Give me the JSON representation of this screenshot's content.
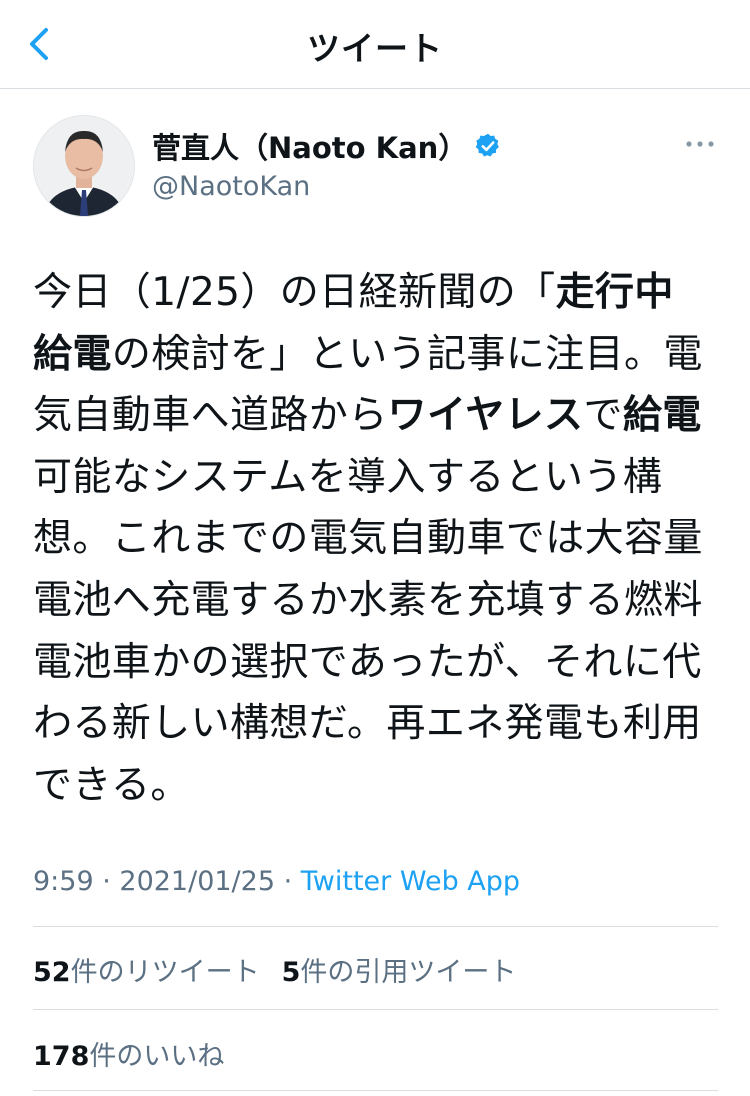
{
  "nav": {
    "title": "ツイート",
    "back_icon": "chevron-left-icon"
  },
  "author": {
    "display_name": "菅直人（Naoto Kan）",
    "handle": "@NaotoKan",
    "verified_icon": "verified-badge-icon",
    "more_icon": "more-horizontal-icon"
  },
  "tweet": {
    "segments": [
      {
        "text": "今日（1/25）の日経新聞の「",
        "bold": false
      },
      {
        "text": "走行中給電",
        "bold": true
      },
      {
        "text": "の検討を」という記事に注目。電気自動車へ道路から",
        "bold": false
      },
      {
        "text": "ワイヤレス",
        "bold": true
      },
      {
        "text": "で",
        "bold": false
      },
      {
        "text": "給電",
        "bold": true
      },
      {
        "text": "可能なシステムを導入するという構想。これまでの電気自動車では大容量電池へ充電するか水素を充填する燃料電池車かの選択であったが、それに代わる新しい構想だ。再エネ発電も利用できる。",
        "bold": false
      }
    ]
  },
  "meta": {
    "time": "9:59",
    "sep1": " · ",
    "date": "2021/01/25",
    "sep2": " · ",
    "source": "Twitter Web App"
  },
  "stats": {
    "retweets_count": "52",
    "retweets_label": "件のリツイート",
    "quotes_count": "5",
    "quotes_label": "件の引用ツイート",
    "likes_count": "178",
    "likes_label": "件のいいね"
  },
  "colors": {
    "accent": "#1da1f2",
    "secondary_text": "#5b7083",
    "divider": "#d9dee2"
  }
}
